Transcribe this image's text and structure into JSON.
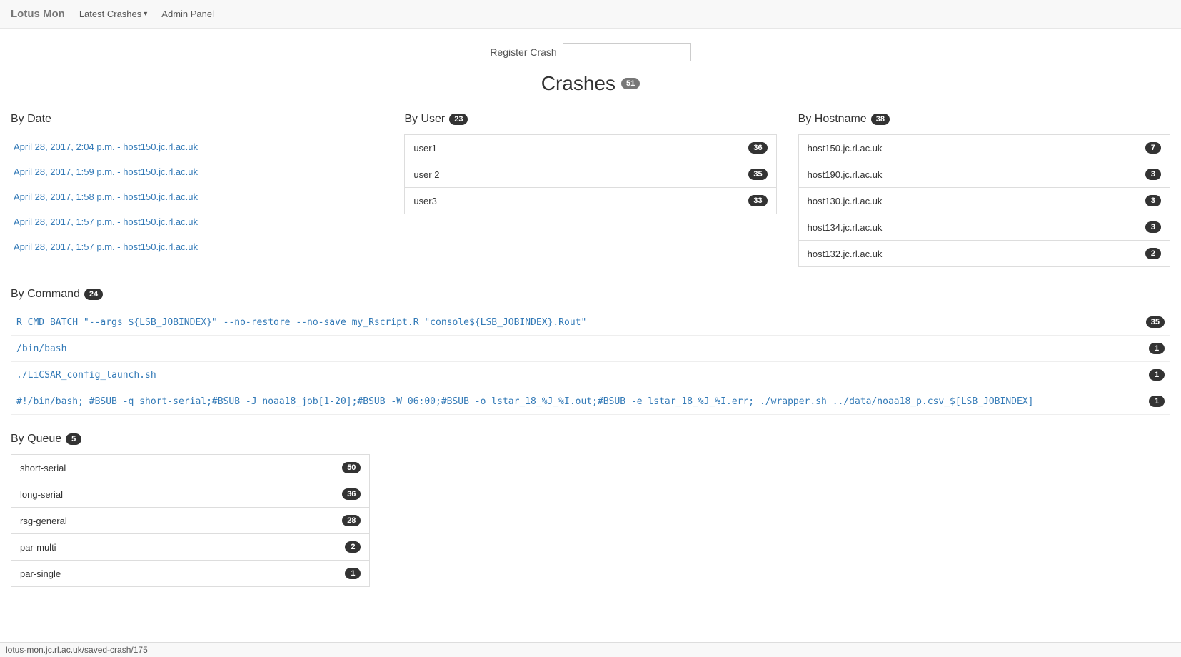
{
  "navbar": {
    "brand": "Lotus Mon",
    "latest_crashes_label": "Latest Crashes",
    "admin_panel_label": "Admin Panel"
  },
  "register": {
    "label": "Register Crash",
    "placeholder": ""
  },
  "page": {
    "title": "Crashes",
    "total_count": "51"
  },
  "by_date": {
    "header": "By Date",
    "items": [
      {
        "text": "April 28, 2017, 2:04 p.m. - host150.jc.rl.ac.uk"
      },
      {
        "text": "April 28, 2017, 1:59 p.m. - host150.jc.rl.ac.uk"
      },
      {
        "text": "April 28, 2017, 1:58 p.m. - host150.jc.rl.ac.uk"
      },
      {
        "text": "April 28, 2017, 1:57 p.m. - host150.jc.rl.ac.uk"
      },
      {
        "text": "April 28, 2017, 1:57 p.m. - host150.jc.rl.ac.uk"
      }
    ]
  },
  "by_user": {
    "header": "By User",
    "count": "23",
    "items": [
      {
        "name": "user1",
        "count": "36"
      },
      {
        "name": "user 2",
        "count": "35"
      },
      {
        "name": "user3",
        "count": "33"
      }
    ]
  },
  "by_hostname": {
    "header": "By Hostname",
    "count": "38",
    "items": [
      {
        "name": "host150.jc.rl.ac.uk",
        "count": "7"
      },
      {
        "name": "host190.jc.rl.ac.uk",
        "count": "3"
      },
      {
        "name": "host130.jc.rl.ac.uk",
        "count": "3"
      },
      {
        "name": "host134.jc.rl.ac.uk",
        "count": "3"
      },
      {
        "name": "host132.jc.rl.ac.uk",
        "count": "2"
      }
    ]
  },
  "by_command": {
    "header": "By Command",
    "count": "24",
    "items": [
      {
        "text": "R CMD BATCH \"--args ${LSB_JOBINDEX}\" --no-restore --no-save my_Rscript.R \"console${LSB_JOBINDEX}.Rout\"",
        "count": "35"
      },
      {
        "text": "/bin/bash",
        "count": "1"
      },
      {
        "text": "./LiCSAR_config_launch.sh",
        "count": "1"
      },
      {
        "text": "#!/bin/bash; #BSUB -q short-serial;#BSUB -J noaa18_job[1-20];#BSUB -W 06:00;#BSUB -o lstar_18_%J_%I.out;#BSUB -e lstar_18_%J_%I.err; ./wrapper.sh ../data/noaa18_p.csv_$[LSB_JOBINDEX]",
        "count": "1"
      }
    ]
  },
  "by_queue": {
    "header": "By Queue",
    "count": "5",
    "items": [
      {
        "name": "short-serial",
        "count": "50"
      },
      {
        "name": "long-serial",
        "count": "36"
      },
      {
        "name": "rsg-general",
        "count": "28"
      },
      {
        "name": "par-multi",
        "count": "2"
      },
      {
        "name": "par-single",
        "count": "1"
      }
    ]
  },
  "statusbar": {
    "text": "lotus-mon.jc.rl.ac.uk/saved-crash/175"
  }
}
